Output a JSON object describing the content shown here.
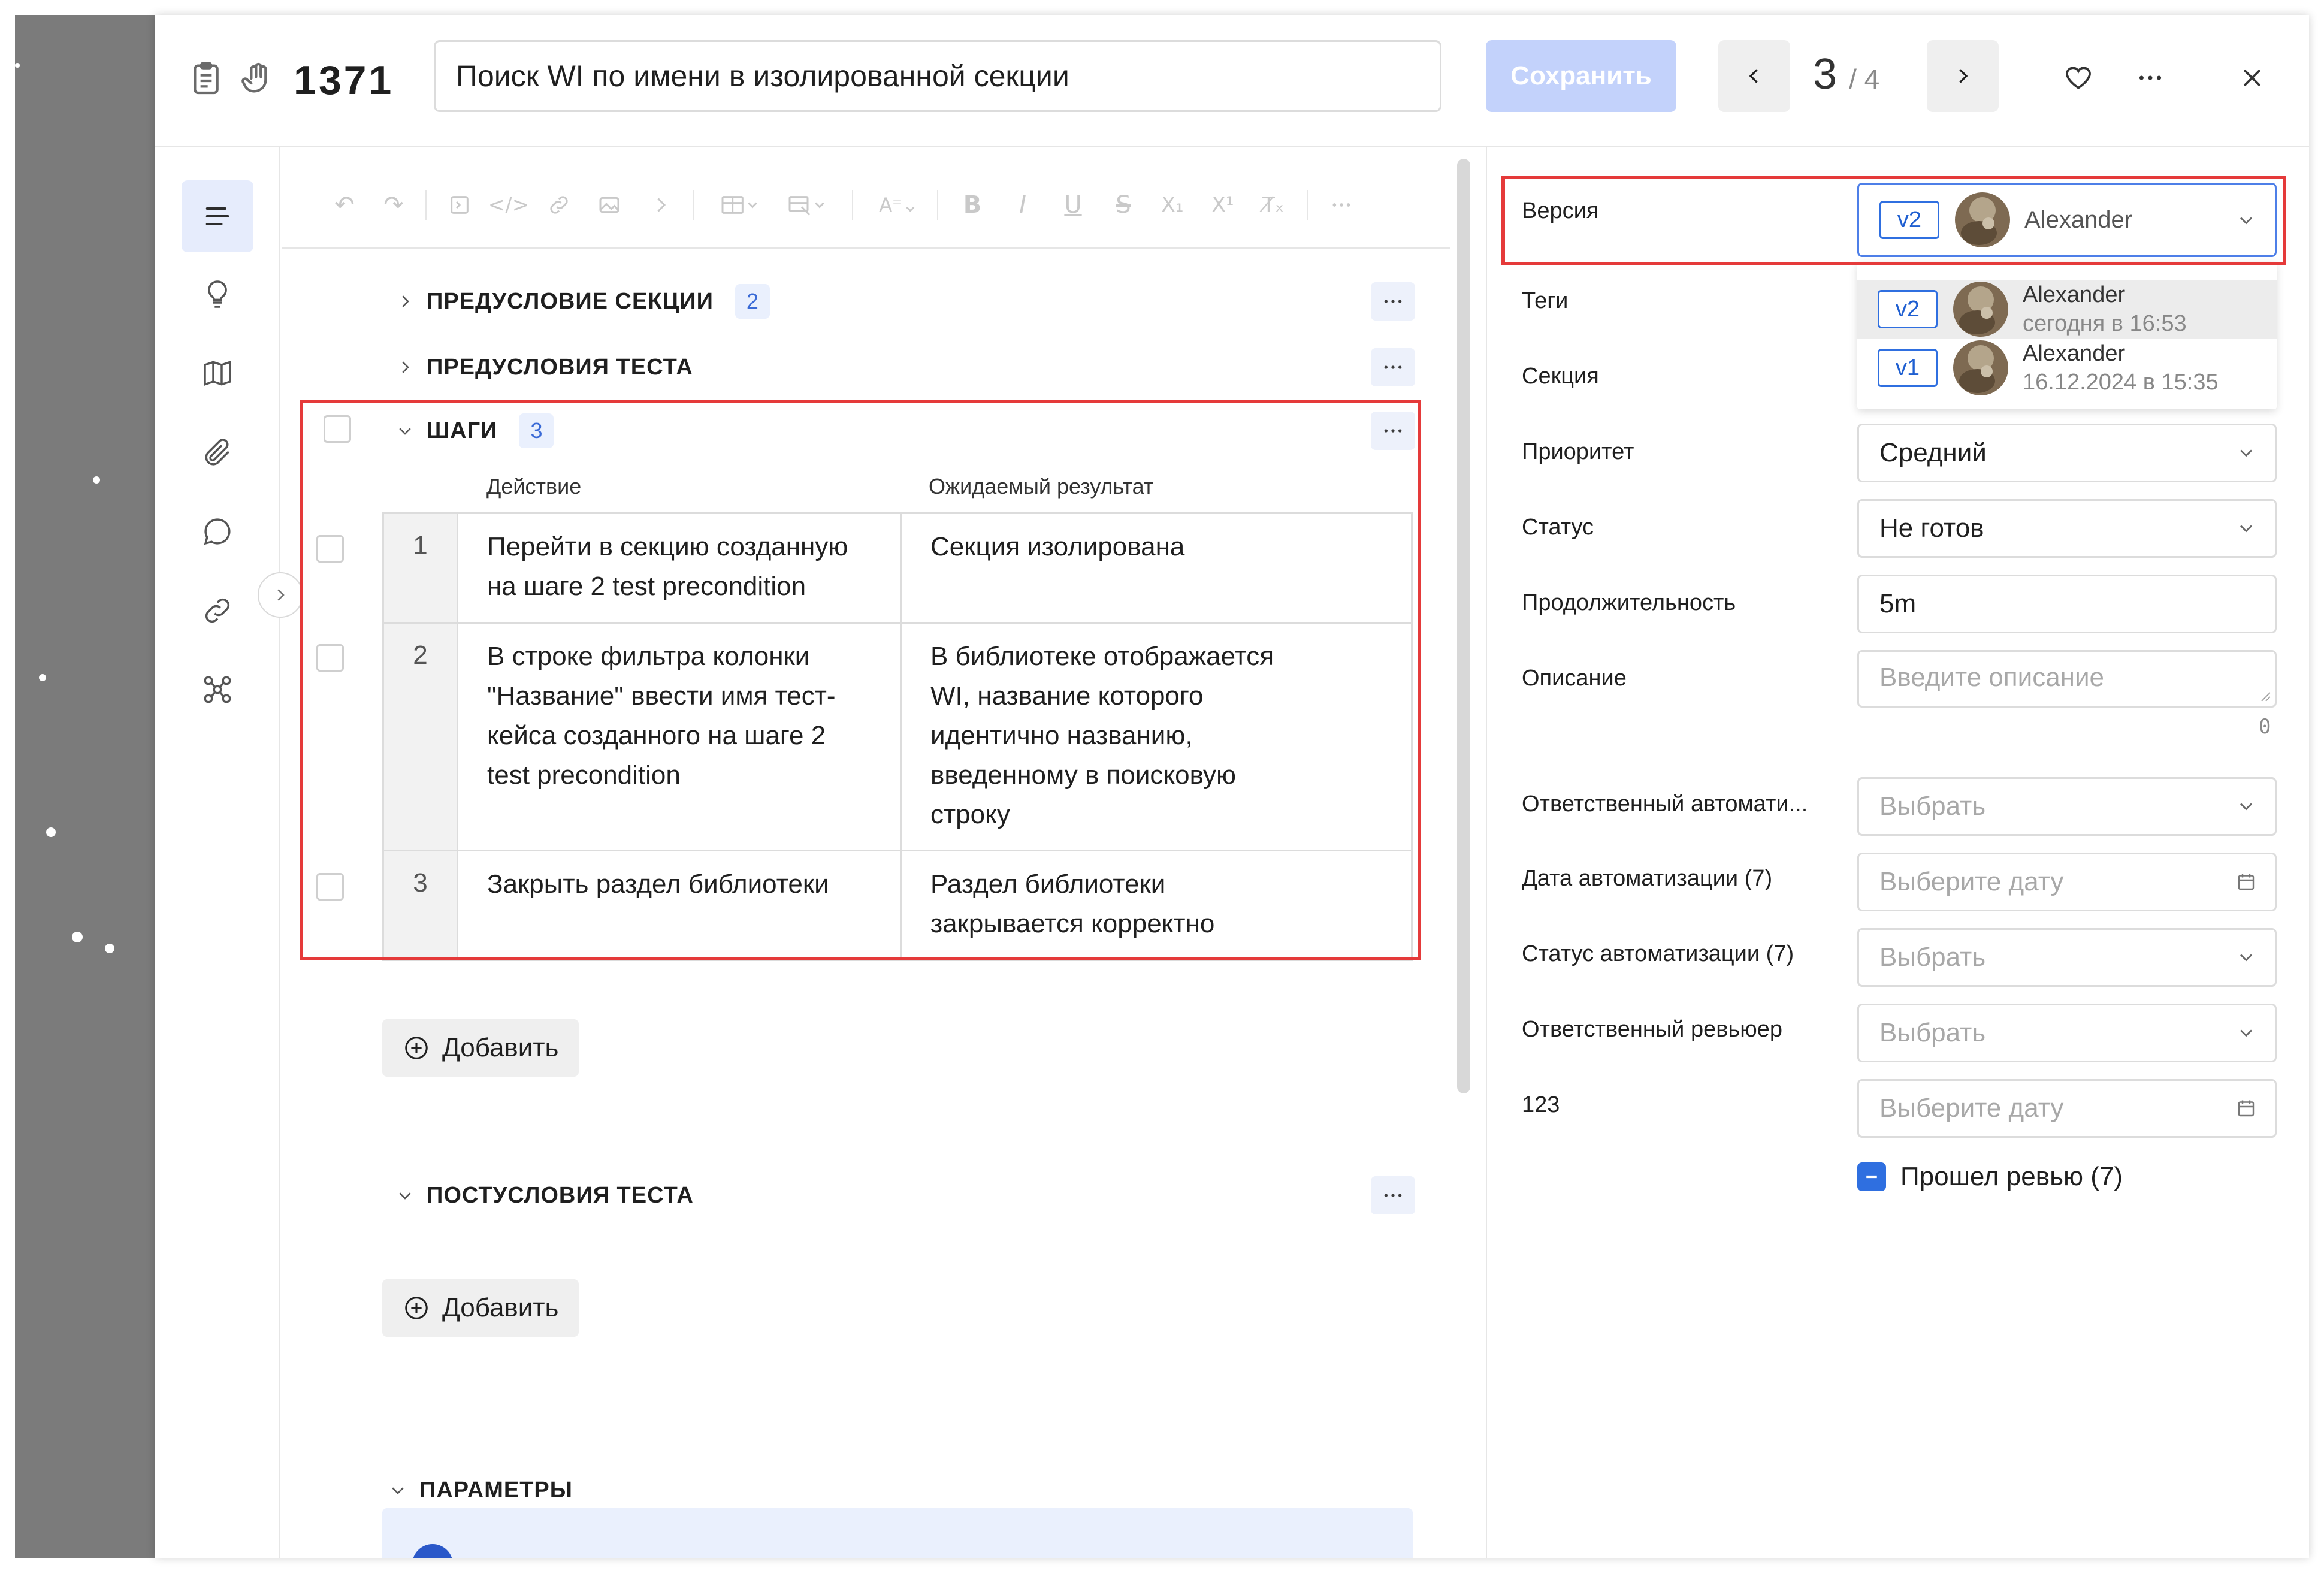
{
  "header": {
    "case_id": "1371",
    "title_value": "Поиск WI по имени в изолированной секции",
    "save_label": "Сохранить",
    "position": "3",
    "total": "/ 4"
  },
  "toolbar": {
    "items": [
      "undo-icon",
      "redo-icon",
      "block-icon",
      "code-icon",
      "link-icon",
      "image-icon",
      "chevron-right-icon",
      "table-icon",
      "table-edit-icon",
      "text-style-icon",
      "bold-icon",
      "italic-icon",
      "underline-icon",
      "strikethrough-icon",
      "subscript-icon",
      "superscript-icon",
      "clear-format-icon",
      "more-icon"
    ]
  },
  "sections": {
    "section_precondition": {
      "title": "ПРЕДУСЛОВИЕ СЕКЦИИ",
      "count": "2"
    },
    "test_preconditions": {
      "title": "ПРЕДУСЛОВИЯ ТЕСТА"
    },
    "steps": {
      "title": "ШАГИ",
      "count": "3",
      "col_action": "Действие",
      "col_expected": "Ожидаемый результат",
      "rows": [
        {
          "num": "1",
          "action": "Перейти в секцию созданную\nна шаге 2 test precondition",
          "expected": "Секция изолирована"
        },
        {
          "num": "2",
          "action": "В строке фильтра колонки\n\"Название\" ввести имя тест-\nкейса созданного на шаге 2\ntest precondition",
          "expected": "В библиотеке отображается\nWI, название которого\nидентично названию,\nвведенному в поисковую\nстроку"
        },
        {
          "num": "3",
          "action": "Закрыть раздел библиотеки",
          "expected": "Раздел библиотеки\nзакрывается корректно"
        }
      ],
      "add_label": "Добавить"
    },
    "postconditions": {
      "title": "ПОСТУСЛОВИЯ ТЕСТА",
      "add_label": "Добавить"
    },
    "parameters": {
      "title": "ПАРАМЕТРЫ"
    }
  },
  "properties": {
    "version": {
      "label": "Версия",
      "selected_badge": "v2",
      "selected_author": "Alexander",
      "options": [
        {
          "badge": "v2",
          "author": "Alexander",
          "date": "сегодня в 16:53"
        },
        {
          "badge": "v1",
          "author": "Alexander",
          "date": "16.12.2024 в 15:35"
        }
      ]
    },
    "tags_label": "Теги",
    "section_label": "Секция",
    "priority": {
      "label": "Приоритет",
      "value": "Средний"
    },
    "status": {
      "label": "Статус",
      "value": "Не готов"
    },
    "duration": {
      "label": "Продолжительность",
      "value": "5m"
    },
    "description": {
      "label": "Описание",
      "placeholder": "Введите описание",
      "char_count": "0"
    },
    "auto_owner": {
      "label": "Ответственный автомати...",
      "placeholder": "Выбрать"
    },
    "auto_date": {
      "label": "Дата автоматизации (7)",
      "placeholder": "Выберите дату"
    },
    "auto_status": {
      "label": "Статус автоматизации (7)",
      "placeholder": "Выбрать"
    },
    "reviewer": {
      "label": "Ответственный ревьюер",
      "placeholder": "Выбрать"
    },
    "custom_123": {
      "label": "123",
      "placeholder": "Выберите дату"
    },
    "review_passed": {
      "label": "Прошел ревью (7)"
    }
  },
  "colors": {
    "accent": "#2f6fe0",
    "save_disabled": "#c3d2fb",
    "highlight_border": "#e53a3a",
    "badge_bg": "#eaf0fd"
  }
}
